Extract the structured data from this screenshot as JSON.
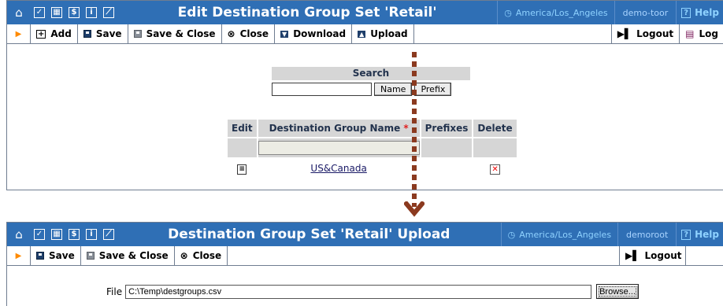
{
  "window1": {
    "title": "Edit Destination Group Set 'Retail'",
    "timezone": "America/Los_Angeles",
    "user": "demo-toor",
    "help": "Help",
    "toolbar": {
      "add": "Add",
      "save": "Save",
      "save_close": "Save & Close",
      "close": "Close",
      "download": "Download",
      "upload": "Upload",
      "logout": "Logout",
      "log": "Log"
    },
    "search": {
      "header": "Search",
      "name_button": "Name",
      "prefix_button": "Prefix",
      "value": ""
    },
    "table": {
      "headers": [
        "Edit",
        "Destination Group Name",
        "Prefixes",
        "Delete"
      ],
      "required_mark": "*",
      "rows": [
        {
          "name": "US&Canada"
        }
      ]
    }
  },
  "window2": {
    "title": "Destination Group Set 'Retail' Upload",
    "timezone": "America/Los_Angeles",
    "user": "demoroot",
    "help": "Help",
    "toolbar": {
      "save": "Save",
      "save_close": "Save & Close",
      "close": "Close",
      "logout": "Logout"
    },
    "upload": {
      "file_label": "File",
      "file_value": "C:\\Temp\\destgroups.csv",
      "browse_button": "Browse..."
    }
  },
  "colors": {
    "titlebar": "#2f6fb5",
    "timezone_text": "#8fd2ff",
    "arrow": "#8b3a1f",
    "toolbar_arrow": "#ff8a00"
  }
}
